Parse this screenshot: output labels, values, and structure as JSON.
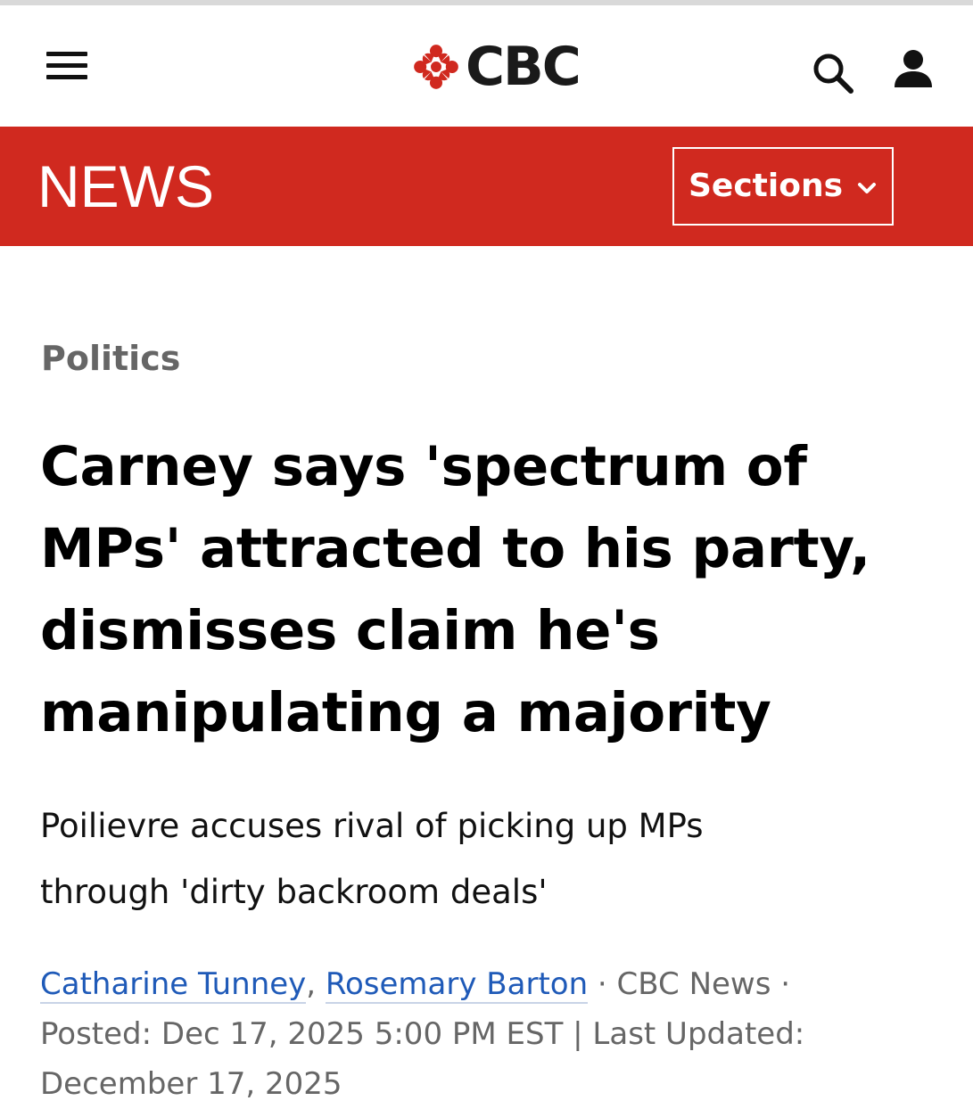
{
  "header": {
    "logo_text": "CBC",
    "brand_color": "#d0291f",
    "icons": [
      "menu-icon",
      "cbc-gem-icon",
      "search-icon",
      "account-icon"
    ]
  },
  "newsbar": {
    "title": "NEWS",
    "sections_label": "Sections",
    "background": "#d0291f"
  },
  "article": {
    "kicker": "Politics",
    "headline": "Carney says 'spectrum of MPs' attracted to his party, dismisses claim he's manipulating a majority",
    "dek": "Poilievre accuses rival of picking up MPs through 'dirty backroom deals'",
    "authors": [
      "Catharine Tunney",
      "Rosemary Barton"
    ],
    "author_separator": ", ",
    "source": " · CBC News · ",
    "posted_label": "Posted: ",
    "posted_date": "Dec 17, 2025 5:00 PM EST",
    "updated_label": " | Last Updated:",
    "updated_date": "December 17, 2025"
  }
}
